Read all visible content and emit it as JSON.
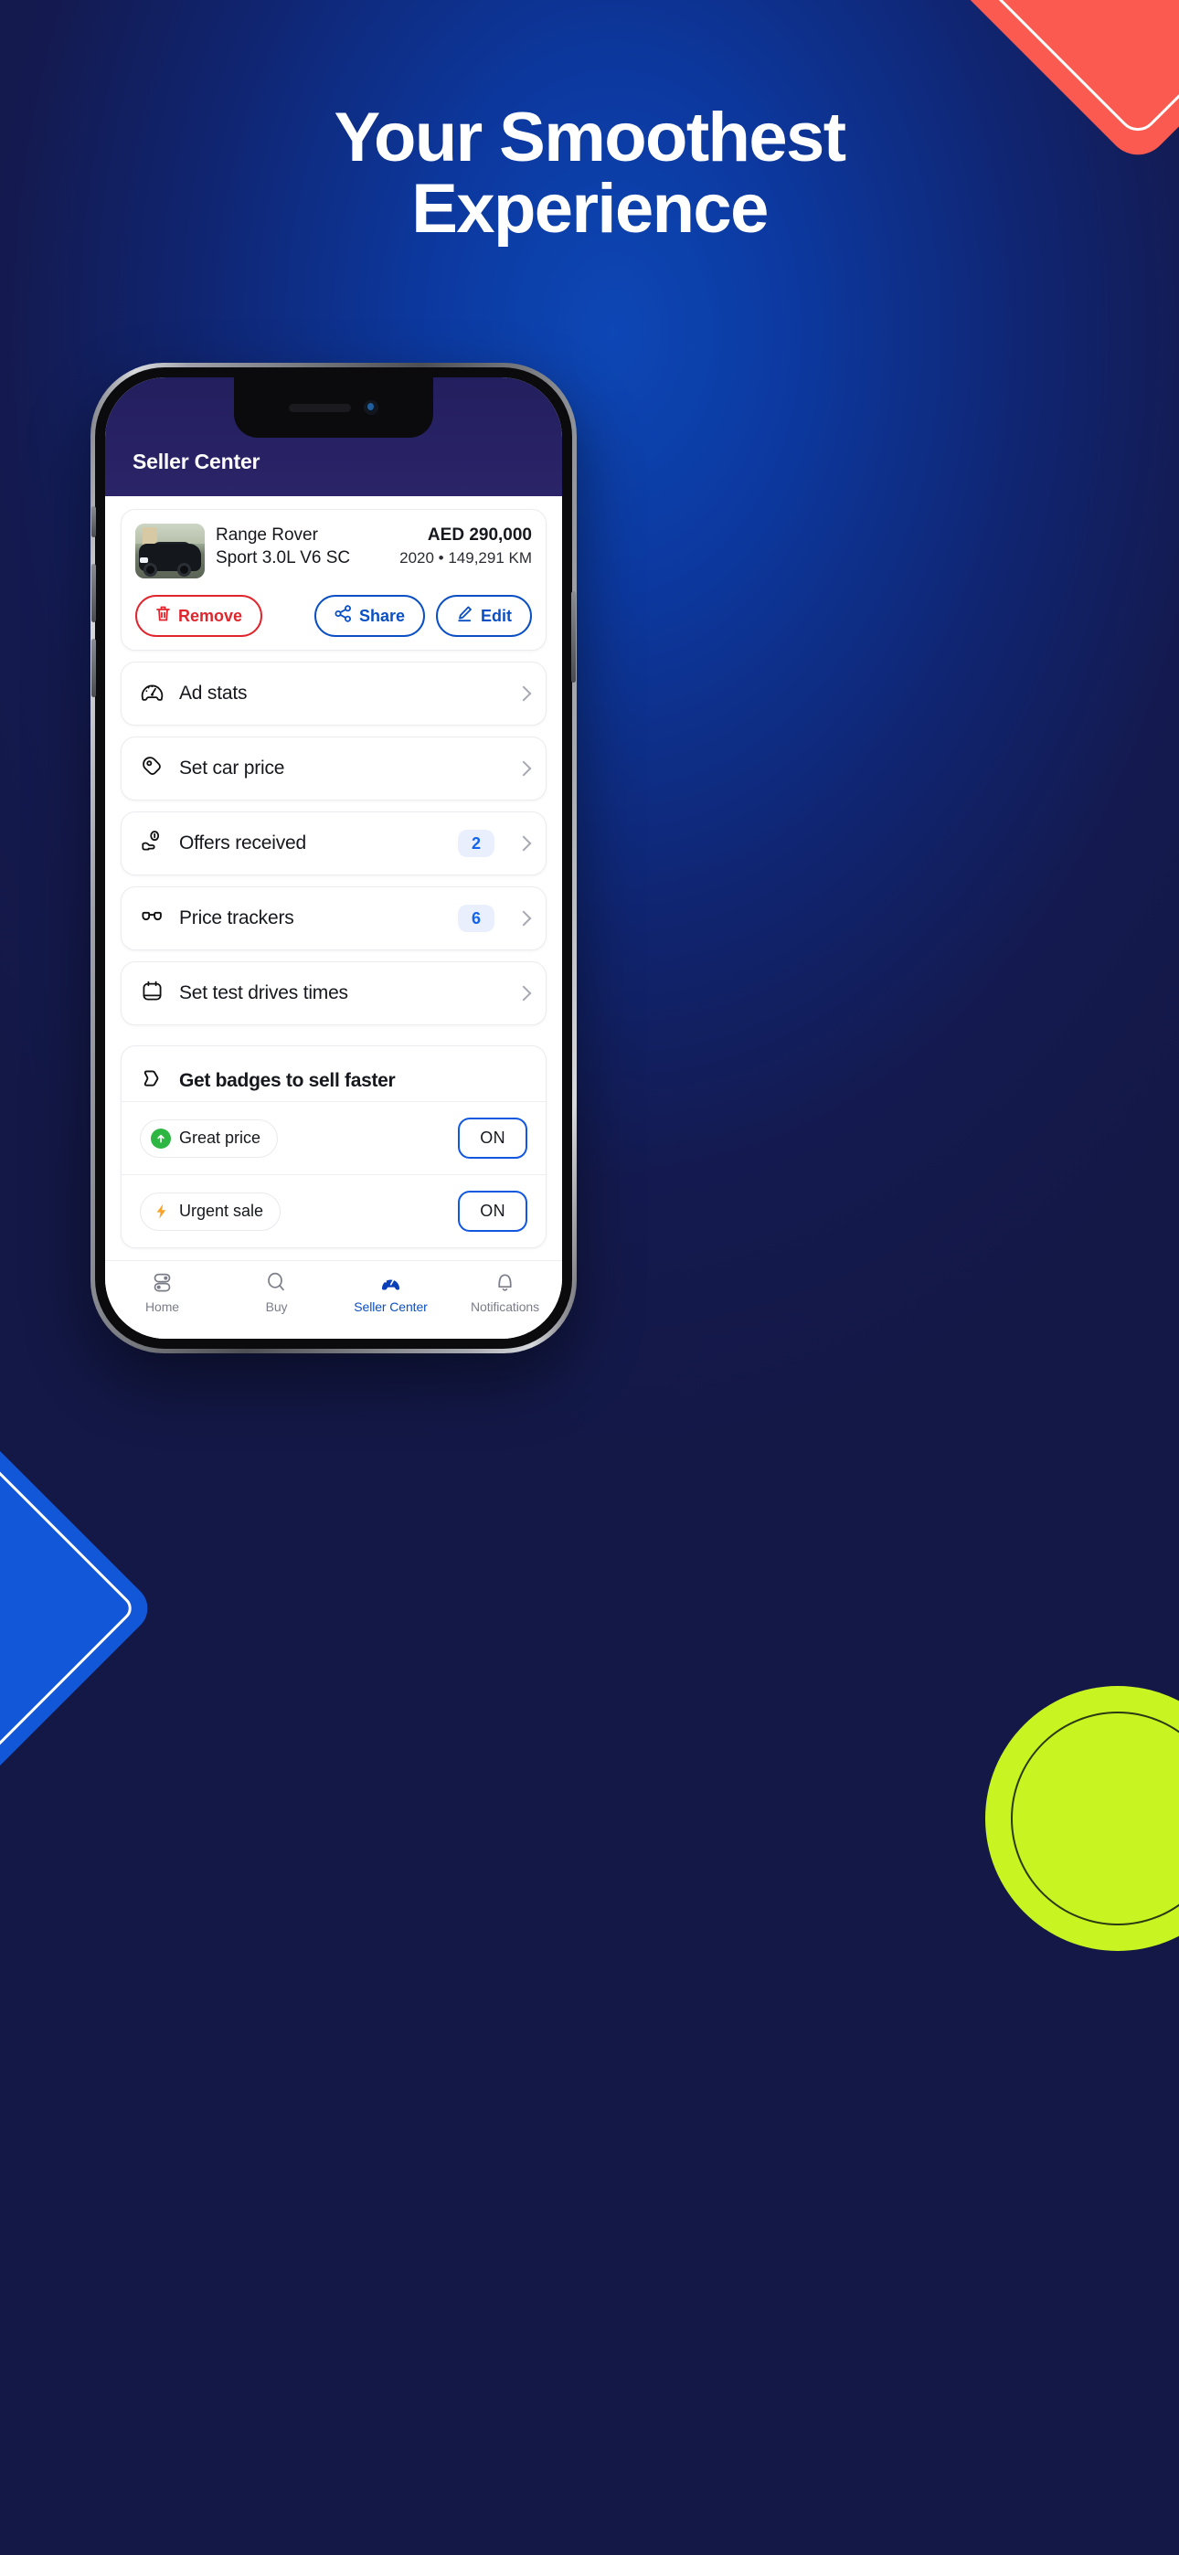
{
  "promo": {
    "headline_line1": "Your Smoothest",
    "headline_line2": "Experience"
  },
  "decor": {
    "coral": "#fa5a50",
    "blue": "#1157d8",
    "lime": "#c8f522",
    "background_deep": "#12184a",
    "background_bright": "#0d47b5"
  },
  "app": {
    "header": {
      "title": "Seller Center"
    },
    "listing": {
      "name_line1": "Range Rover",
      "name_line2": "Sport 3.0L V6 SC",
      "price": "AED 290,000",
      "meta": "2020  •  149,291 KM",
      "thumbnail_alt": "black-range-rover-sport-photo",
      "actions": {
        "remove": "Remove",
        "share": "Share",
        "edit": "Edit"
      }
    },
    "menu": [
      {
        "label": "Ad stats",
        "icon": "gauge-icon",
        "badge": ""
      },
      {
        "label": "Set car price",
        "icon": "price-tag-icon",
        "badge": ""
      },
      {
        "label": "Offers received",
        "icon": "hand-offer-icon",
        "badge": "2"
      },
      {
        "label": "Price trackers",
        "icon": "glasses-icon",
        "badge": "6"
      },
      {
        "label": "Set test drives times",
        "icon": "calendar-icon",
        "badge": ""
      }
    ],
    "badges_section": {
      "title": "Get badges to sell faster",
      "icon": "badge-tag-icon",
      "rows": [
        {
          "label": "Great price",
          "icon": "green-up-arrow-icon",
          "icon_color": "#2db742",
          "state": "ON"
        },
        {
          "label": "Urgent sale",
          "icon": "orange-lightning-icon",
          "icon_color": "#f7a32a",
          "state": "ON"
        }
      ]
    },
    "tabs": [
      {
        "label": "Home",
        "icon": "toggles-icon",
        "active": false
      },
      {
        "label": "Buy",
        "icon": "search-icon",
        "active": false
      },
      {
        "label": "Seller Center",
        "icon": "gauge-filled-icon",
        "active": true
      },
      {
        "label": "Notifications",
        "icon": "bell-icon",
        "active": false
      }
    ],
    "accent_color": "#0b4fc4",
    "danger_color": "#e0252d"
  }
}
